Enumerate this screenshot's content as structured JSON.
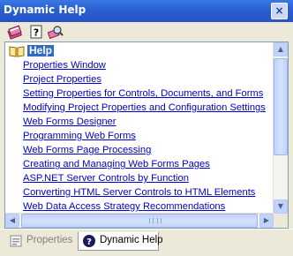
{
  "window": {
    "title": "Dynamic Help",
    "close_glyph": "×"
  },
  "toolbar": {
    "icons": [
      "books-icon",
      "question-icon",
      "search-icon"
    ]
  },
  "help": {
    "heading": "Help",
    "links": [
      "Properties Window",
      "Project Properties",
      "Setting Properties for Controls, Documents, and Forms",
      "Modifying Project Properties and Configuration Settings",
      "Web Forms Designer",
      "Programming Web Forms",
      "Web Forms Page Processing",
      "Creating and Managing Web Forms Pages",
      "ASP.NET Server Controls by Function",
      "Converting HTML Server Controls to HTML Elements",
      "Web Data Access Strategy Recommendations"
    ]
  },
  "tabs": {
    "properties": "Properties",
    "dynamic_help": "Dynamic Help"
  },
  "colors": {
    "titlebar": "#2a5fd0",
    "link": "#0000cc",
    "selection": "#316ac5"
  }
}
